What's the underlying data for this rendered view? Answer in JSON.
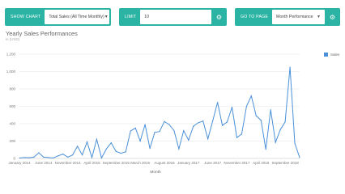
{
  "toolbar": {
    "show_chart_label": "SHOW CHART",
    "show_chart_value": "Total Sales (All Time Monthly)",
    "limit_label": "LIMIT",
    "limit_value": "10",
    "goto_label": "GO TO PAGE",
    "goto_value": "Month Performance"
  },
  "chart": {
    "title": "Yearly Sales Performances",
    "subtitle": "in (USD)",
    "legend_label": "Sales"
  },
  "chart_data": {
    "type": "line",
    "title": "Yearly Sales Performances",
    "subtitle": "in (USD)",
    "xlabel": "Month",
    "ylabel": "",
    "ylim": [
      0,
      1200
    ],
    "yticks": [
      0,
      200,
      400,
      600,
      800,
      "1,000",
      "1,200"
    ],
    "x_tick_labels": [
      "January 2014",
      "June 2014",
      "November 2014",
      "April 2015",
      "September 2015",
      "March 2016",
      "August 2016",
      "January 2017",
      "June 2017",
      "November 2017",
      "April 2018",
      "September 2018"
    ],
    "series": [
      {
        "name": "Sales",
        "color": "#4a90d9",
        "values": [
          5,
          10,
          8,
          15,
          65,
          15,
          10,
          5,
          30,
          50,
          15,
          40,
          140,
          40,
          190,
          10,
          220,
          5,
          110,
          180,
          80,
          60,
          75,
          315,
          350,
          200,
          390,
          115,
          300,
          310,
          425,
          390,
          320,
          110,
          320,
          210,
          370,
          410,
          430,
          225,
          430,
          645,
          380,
          420,
          590,
          240,
          280,
          600,
          720,
          490,
          440,
          105,
          560,
          185,
          330,
          420,
          1050,
          175,
          10
        ]
      }
    ]
  }
}
